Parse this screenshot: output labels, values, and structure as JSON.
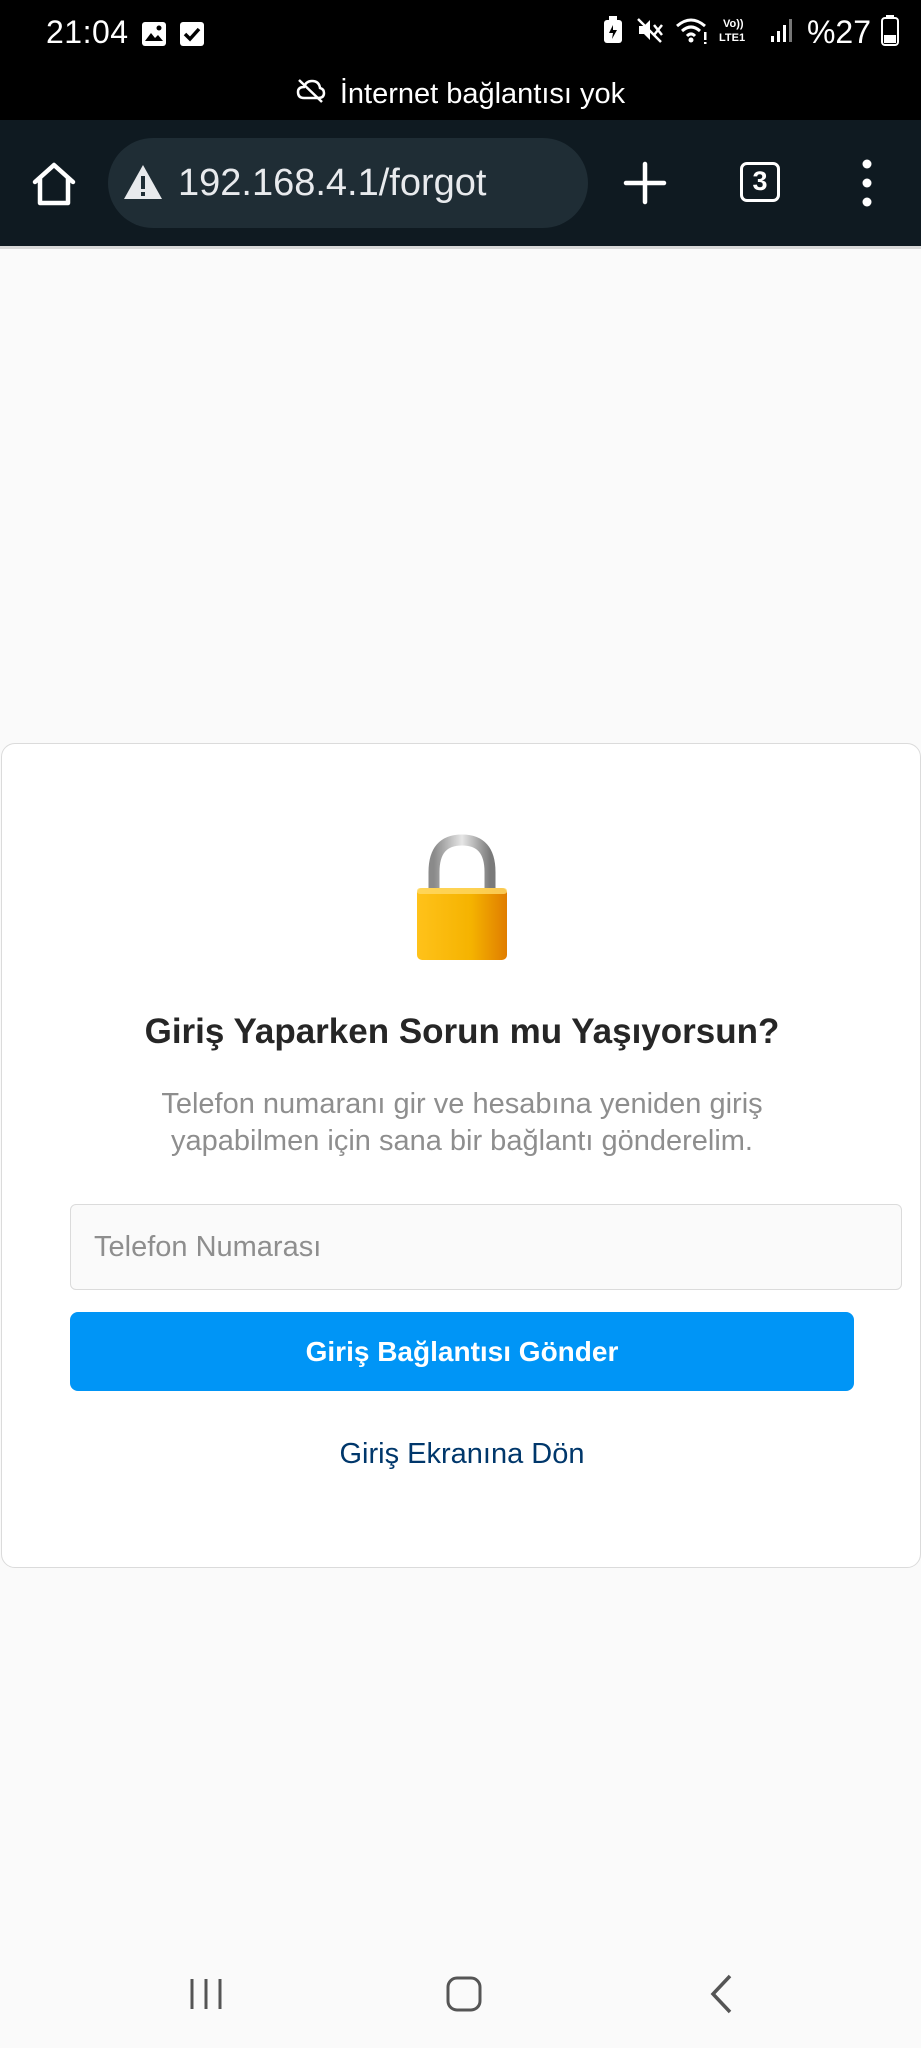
{
  "status_bar": {
    "time": "21:04",
    "battery": "%27",
    "network_label": "Vo)) LTE1"
  },
  "offline_banner": {
    "text": "İnternet bağlantısı yok"
  },
  "browser": {
    "url": "192.168.4.1/forgot",
    "tab_count": "3"
  },
  "card": {
    "title": "Giriş Yaparken Sorun mu Yaşıyorsun?",
    "description": "Telefon numaranı gir ve hesabına yeniden giriş yapabilmen için sana bir bağlantı gönderelim.",
    "phone_placeholder": "Telefon Numarası",
    "phone_value": "",
    "send_button": "Giriş Bağlantısı Gönder",
    "back_link": "Giriş Ekranına Dön"
  },
  "colors": {
    "primary_button": "#0095f6",
    "link": "#00376b",
    "toolbar": "#0f1a21"
  }
}
